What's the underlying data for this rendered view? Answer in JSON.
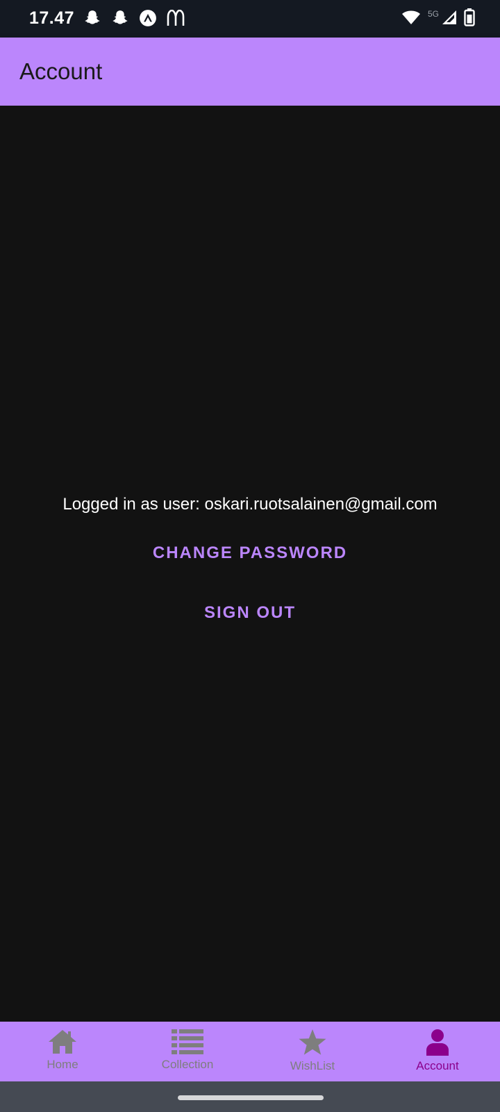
{
  "status_bar": {
    "time": "17.47",
    "network_label": "5G",
    "left_icons": [
      "snapchat-icon",
      "snapchat-icon",
      "expo-icon",
      "mcdonalds-icon"
    ],
    "right_icons": [
      "wifi-icon",
      "signal-icon",
      "battery-icon"
    ]
  },
  "app_bar": {
    "title": "Account"
  },
  "main": {
    "logged_in_text": "Logged in as user: oskari.ruotsalainen@gmail.com",
    "change_password_label": "CHANGE PASSWORD",
    "sign_out_label": "SIGN OUT"
  },
  "bottom_nav": {
    "items": [
      {
        "label": "Home",
        "icon": "home-icon",
        "active": false
      },
      {
        "label": "Collection",
        "icon": "list-icon",
        "active": false
      },
      {
        "label": "WishList",
        "icon": "star-icon",
        "active": false
      },
      {
        "label": "Account",
        "icon": "person-icon",
        "active": true
      }
    ]
  },
  "colors": {
    "accent": "#bb86fc",
    "background": "#121212",
    "active_nav": "#8b008b",
    "inactive_nav": "#7e7e7e"
  }
}
